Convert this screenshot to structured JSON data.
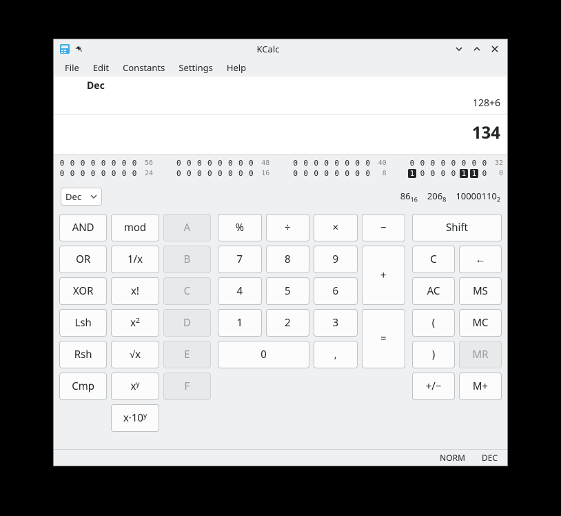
{
  "window": {
    "title": "KCalc"
  },
  "menu": {
    "file": "File",
    "edit": "Edit",
    "constants": "Constants",
    "settings": "Settings",
    "help": "Help"
  },
  "display": {
    "mode": "Dec",
    "expression": "128+6",
    "result": "134"
  },
  "bits": {
    "row1": [
      {
        "bits": [
          "0",
          "0",
          "0",
          "0",
          "0",
          "0",
          "0",
          "0"
        ],
        "label": "56"
      },
      {
        "bits": [
          "0",
          "0",
          "0",
          "0",
          "0",
          "0",
          "0",
          "0"
        ],
        "label": "48"
      },
      {
        "bits": [
          "0",
          "0",
          "0",
          "0",
          "0",
          "0",
          "0",
          "0"
        ],
        "label": "40"
      },
      {
        "bits": [
          "0",
          "0",
          "0",
          "0",
          "0",
          "0",
          "0",
          "0"
        ],
        "label": "32"
      }
    ],
    "row2": [
      {
        "bits": [
          "0",
          "0",
          "0",
          "0",
          "0",
          "0",
          "0",
          "0"
        ],
        "label": "24"
      },
      {
        "bits": [
          "0",
          "0",
          "0",
          "0",
          "0",
          "0",
          "0",
          "0"
        ],
        "label": "16"
      },
      {
        "bits": [
          "0",
          "0",
          "0",
          "0",
          "0",
          "0",
          "0",
          "0"
        ],
        "label": "8"
      },
      {
        "bits": [
          "1",
          "0",
          "0",
          "0",
          "0",
          "1",
          "1",
          "0"
        ],
        "label": "0"
      }
    ]
  },
  "base_select": "Dec",
  "readouts": {
    "hex": "86",
    "hex_sub": "16",
    "oct": "206",
    "oct_sub": "8",
    "bin": "10000110",
    "bin_sub": "2"
  },
  "keys": {
    "and": "AND",
    "mod": "mod",
    "a": "A",
    "or": "OR",
    "inv": "1/x",
    "b": "B",
    "xor": "XOR",
    "fact": "x!",
    "c": "C",
    "lsh": "Lsh",
    "sq": "x",
    "sq_sup": "2",
    "d": "D",
    "rsh": "Rsh",
    "sqrt": "√x",
    "e": "E",
    "cmp": "Cmp",
    "pow": "x",
    "pow_sup": "y",
    "f": "F",
    "sci": "x·10",
    "sci_sup": "y",
    "pct": "%",
    "div": "÷",
    "mul": "×",
    "sub": "−",
    "n7": "7",
    "n8": "8",
    "n9": "9",
    "add": "+",
    "n4": "4",
    "n5": "5",
    "n6": "6",
    "n1": "1",
    "n2": "2",
    "n3": "3",
    "eq": "=",
    "n0": "0",
    "comma": ",",
    "shift": "Shift",
    "clr": "C",
    "back": "←",
    "ac": "AC",
    "ms": "MS",
    "lp": "(",
    "mc": "MC",
    "rp": ")",
    "mr": "MR",
    "pm": "+/−",
    "mp": "M+"
  },
  "status": {
    "mode": "NORM",
    "base": "DEC"
  }
}
